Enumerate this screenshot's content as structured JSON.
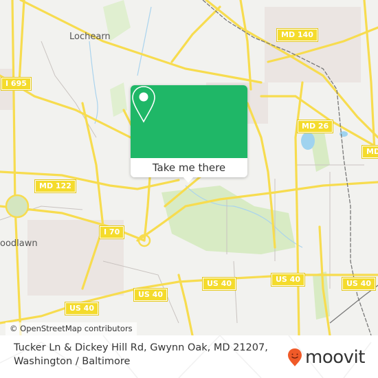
{
  "map": {
    "colors": {
      "background": "#f2f2ef",
      "road": "#f7dc4f",
      "water": "#9fd3ef",
      "park": "#d8ebc4",
      "urban": "#e9e2df",
      "rail": "#777777",
      "accent_green": "#1fb767",
      "moovit_orange": "#f05a28"
    },
    "places": [
      "Lochearn",
      "oodlawn"
    ],
    "shields": [
      "I 695",
      "MD 140",
      "MD 26",
      "MD",
      "MD 122",
      "I 70",
      "US 40",
      "US 40",
      "US 40",
      "US 40",
      "US 40"
    ],
    "attribution": "© OpenStreetMap contributors"
  },
  "popup": {
    "icon": "map-pin-icon",
    "button_label": "Take me there"
  },
  "footer": {
    "address_line1": "Tucker Ln & Dickey Hill Rd, Gwynn Oak, MD 21207,",
    "address_line2": "Washington / Baltimore",
    "brand": "moovit",
    "brand_icon": "moovit-pin-smile-icon"
  }
}
